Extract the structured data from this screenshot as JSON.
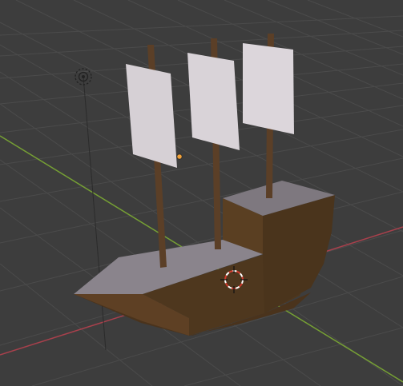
{
  "viewport": {
    "background": "#3d3d3d",
    "grid_color": "#4a4a4a",
    "axis_x_color": "#b0434f",
    "axis_y_color": "#7ea53a"
  },
  "scene": {
    "objects": [
      {
        "name": "hull",
        "color": "#5a3f22"
      },
      {
        "name": "deck",
        "color": "#8b858e"
      },
      {
        "name": "masts",
        "color": "#5b3f27",
        "count": 3
      },
      {
        "name": "sails",
        "color": "#d8d2d6",
        "count": 3
      }
    ],
    "overlays": [
      {
        "name": "light-gizmo-icon"
      },
      {
        "name": "3d-cursor-icon"
      },
      {
        "name": "object-origin-dot",
        "color": "#f2a23a"
      }
    ]
  }
}
